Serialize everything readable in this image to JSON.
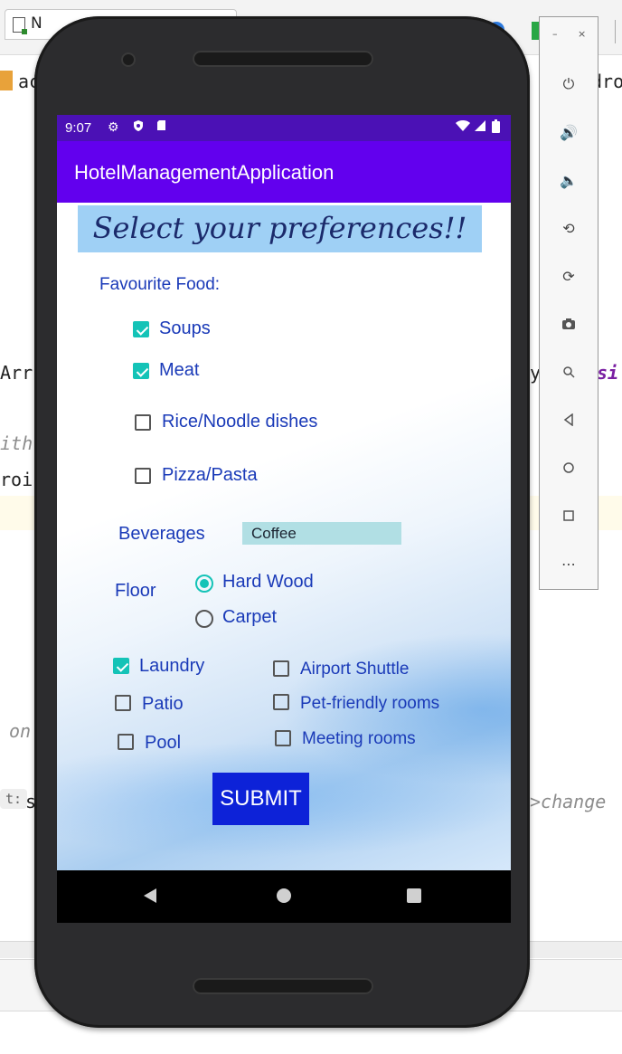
{
  "ide": {
    "tab_title": "N",
    "line_1": "ac",
    "line_1_right": "dro",
    "line_arr": "Arr",
    "line_arr_right_1": "y",
    "line_arr_right_2": "si",
    "line_ith": "ith",
    "line_roi": "roi",
    "line_on": "on",
    "chip": "t:",
    "line_s": "s",
    "line_change": ">change"
  },
  "emulator_toolbar": {
    "minimize": "–",
    "close": "×",
    "buttons": [
      "power-icon",
      "volume-up-icon",
      "volume-down-icon",
      "rotate-left-icon",
      "rotate-right-icon",
      "camera-icon",
      "zoom-icon",
      "back-icon",
      "home-icon",
      "overview-icon",
      "more-icon"
    ]
  },
  "status_bar": {
    "time": "9:07"
  },
  "app_bar": {
    "title": "HotelManagementApplication"
  },
  "form": {
    "banner": "Select your preferences!!",
    "food_label": "Favourite Food:",
    "food_options": [
      {
        "label": "Soups",
        "checked": true
      },
      {
        "label": "Meat",
        "checked": true
      },
      {
        "label": "Rice/Noodle dishes",
        "checked": false
      },
      {
        "label": "Pizza/Pasta",
        "checked": false
      }
    ],
    "beverages_label": "Beverages",
    "beverages_value": "Coffee",
    "floor_label": "Floor",
    "floor_options": [
      {
        "label": "Hard Wood",
        "selected": true
      },
      {
        "label": "Carpet",
        "selected": false
      }
    ],
    "amenities": [
      {
        "label": "Laundry",
        "checked": true
      },
      {
        "label": "Patio",
        "checked": false
      },
      {
        "label": "Pool",
        "checked": false
      },
      {
        "label": "Airport Shuttle",
        "checked": false
      },
      {
        "label": "Pet-friendly rooms",
        "checked": false
      },
      {
        "label": "Meeting rooms",
        "checked": false
      }
    ],
    "submit_label": "SUBMIT"
  },
  "colors": {
    "status_bar": "#4b11b5",
    "app_bar": "#6200ee",
    "accent_teal": "#14c3b7",
    "label_blue": "#1a3ab8",
    "submit_bg": "#0d22d8",
    "banner_bg": "#9fd0f5"
  }
}
